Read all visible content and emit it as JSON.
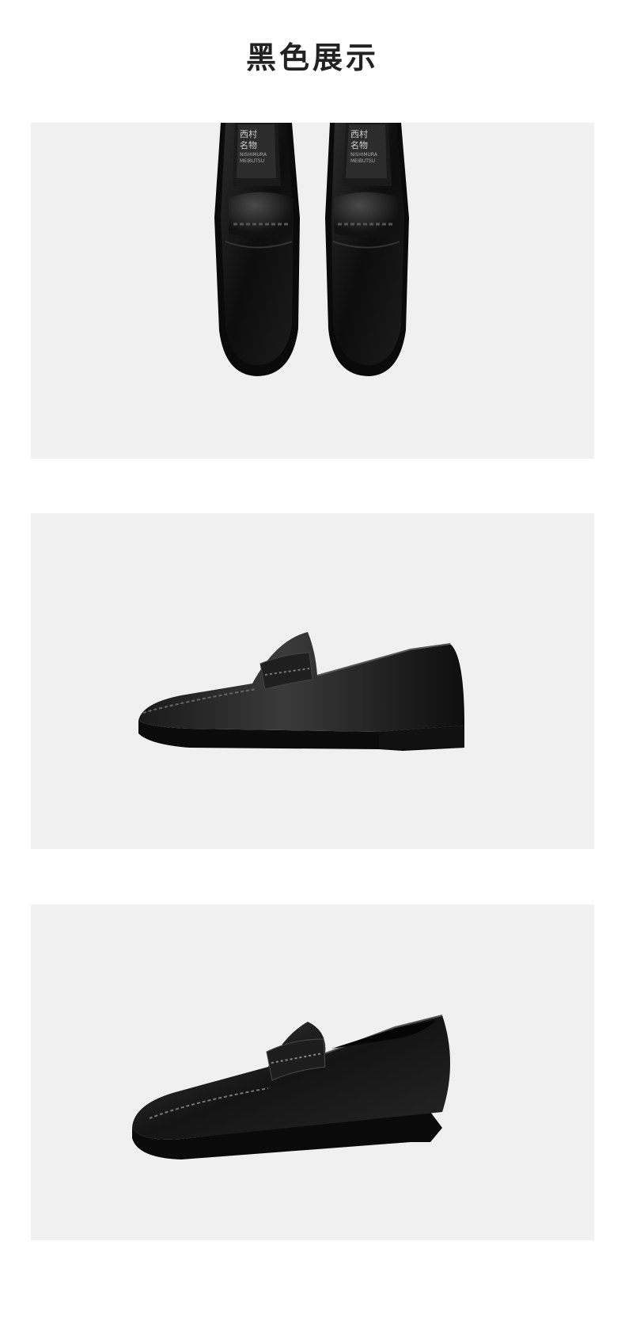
{
  "header": {
    "title": "黑色展示"
  },
  "product": {
    "color_name": "黑色",
    "shoe_color": "#111111",
    "background_color": "#f0f0f0",
    "insole_brand": [
      "西村",
      "名物",
      "NISHIMURA",
      "MEIBUTSU"
    ]
  },
  "panels": [
    {
      "view": "top-view-pair"
    },
    {
      "view": "side-view"
    },
    {
      "view": "three-quarter-view"
    }
  ]
}
